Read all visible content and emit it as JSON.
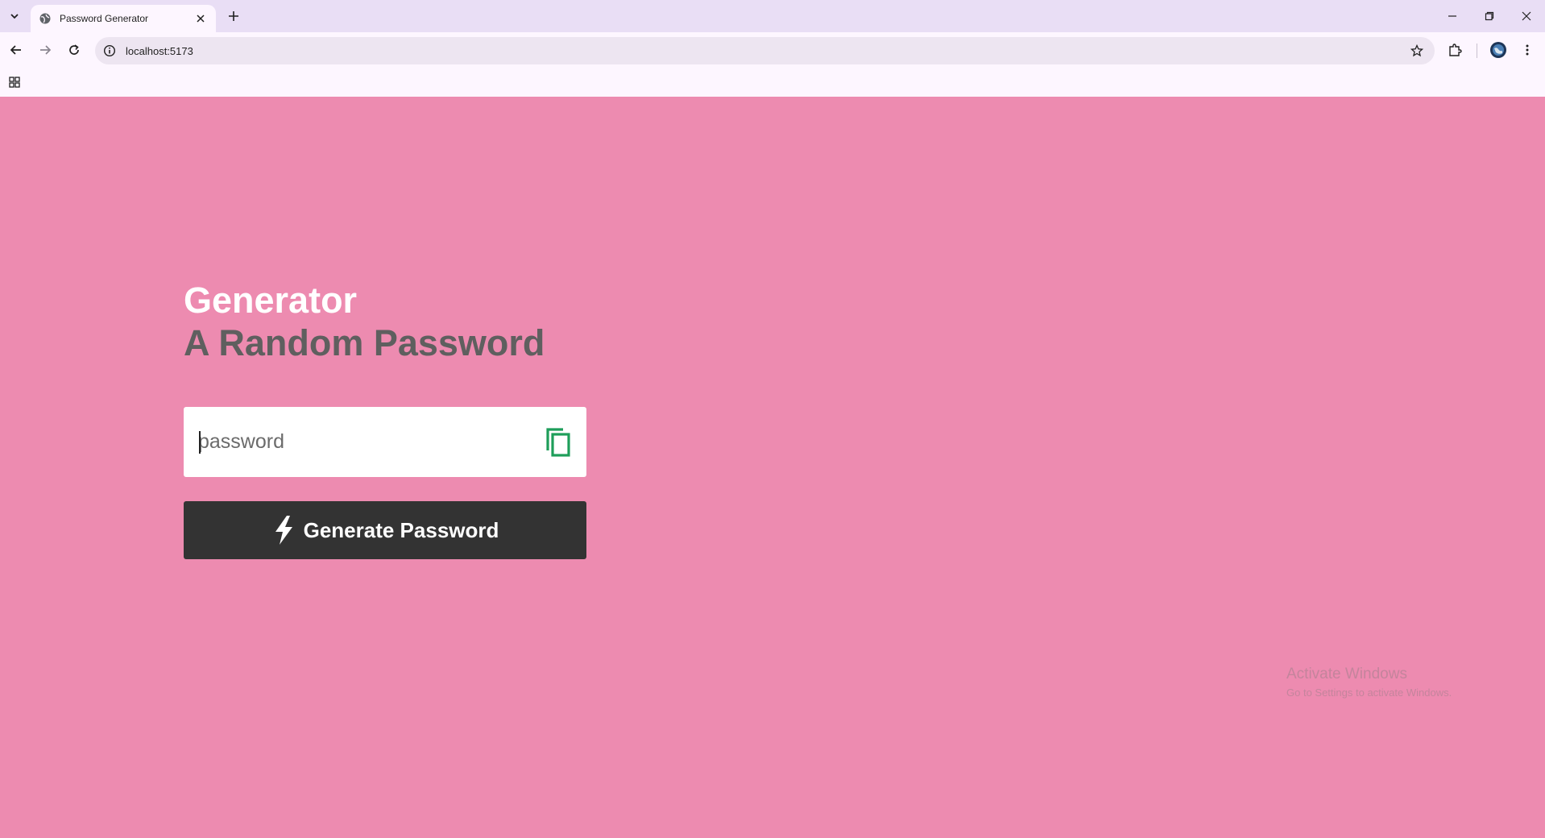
{
  "browser": {
    "tab_title": "Password Generator",
    "url": "localhost:5173",
    "icons": {
      "tab_search": "chevron-down-icon",
      "favicon": "globe-icon",
      "tab_close": "close-icon",
      "new_tab": "plus-icon",
      "back": "arrow-left-icon",
      "forward": "arrow-right-icon",
      "reload": "reload-icon",
      "site_info": "info-icon",
      "bookmark": "star-icon",
      "extensions": "puzzle-icon",
      "profile": "avatar",
      "menu": "kebab-menu-icon",
      "apps": "apps-grid-icon"
    }
  },
  "page": {
    "title_line1": "Generator",
    "title_line2": "A Random Password",
    "password_placeholder": "password",
    "password_value": "",
    "generate_label": "Generate Password",
    "colors": {
      "background": "#ED8BB0",
      "title_primary": "#FFFFFF",
      "title_secondary": "#5F5F5F",
      "button_bg": "#333333",
      "copy_icon": "#1E9E5A"
    }
  },
  "os_watermark": {
    "line1": "Activate Windows",
    "line2": "Go to Settings to activate Windows."
  }
}
